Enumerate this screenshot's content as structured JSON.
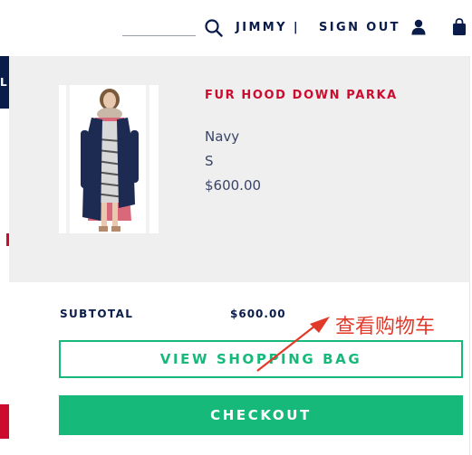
{
  "header": {
    "search_icon": "search-icon",
    "account_name": "JIMMY |",
    "sign_out_label": "SIGN OUT",
    "user_icon": "user-icon",
    "bag_icon": "shopping-bag-icon"
  },
  "left_edge": {
    "tab_letter": "L"
  },
  "cart": {
    "item": {
      "name": "FUR HOOD DOWN PARKA",
      "color": "Navy",
      "size": "S",
      "price": "$600.00"
    },
    "subtotal_label": "SUBTOTAL",
    "subtotal_value": "$600.00",
    "view_bag_label": "VIEW SHOPPING BAG",
    "checkout_label": "CHECKOUT"
  },
  "annotation": {
    "text": "查看购物车",
    "color": "#e23a2a"
  },
  "colors": {
    "brand_navy": "#0a1c4a",
    "brand_red": "#cc0c2f",
    "accent_green": "#17b97b",
    "panel_gray": "#efefef"
  }
}
